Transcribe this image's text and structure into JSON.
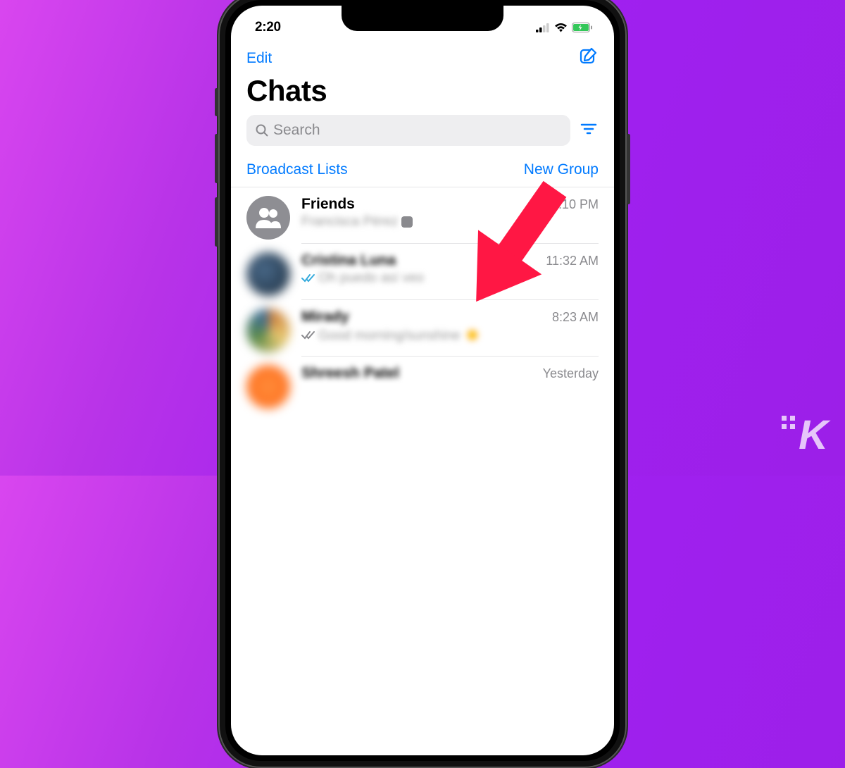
{
  "status": {
    "time": "2:20"
  },
  "header": {
    "edit_label": "Edit",
    "title": "Chats",
    "search_placeholder": "Search",
    "broadcast_label": "Broadcast Lists",
    "newgroup_label": "New Group"
  },
  "chats": [
    {
      "name": "Friends",
      "time": "12:10 PM",
      "preview": "Francisca Pérez",
      "type": "group",
      "ticks": "none"
    },
    {
      "name": "Cristina Luna",
      "time": "11:32 AM",
      "preview": "Oh puedo así veo",
      "type": "person",
      "ticks": "read"
    },
    {
      "name": "Mirady",
      "time": "8:23 AM",
      "preview": "Good morning/sunshine ☀️",
      "type": "person",
      "ticks": "sent"
    },
    {
      "name": "Shreesh Patel",
      "time": "Yesterday",
      "preview": "",
      "type": "person",
      "ticks": "none"
    }
  ],
  "watermark": "K"
}
